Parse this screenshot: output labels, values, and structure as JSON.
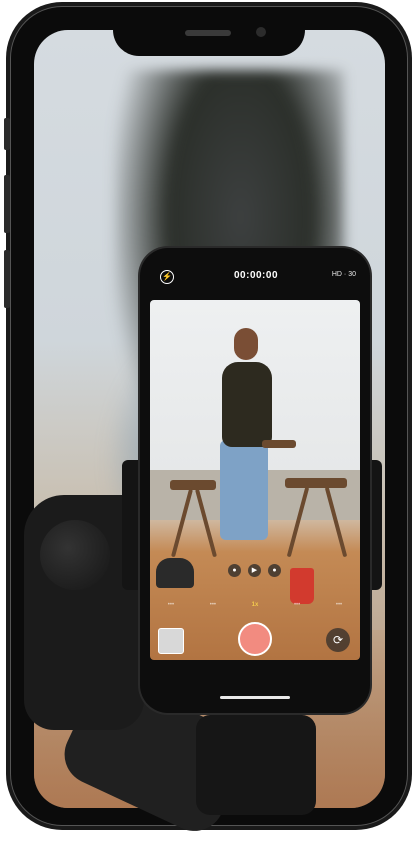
{
  "camera": {
    "timer": "00:00:00",
    "quality": "HD · 30",
    "flash_icon": "flash-off-icon",
    "mode_icons": [
      "lock-icon",
      "play-icon",
      "lock-icon"
    ],
    "speed_options": [
      "•••",
      "•••",
      "1x",
      "•••",
      "•••"
    ],
    "active_speed": "1x",
    "record_color": "#f28b80",
    "flip_icon": "rotate-camera-icon"
  },
  "device": {
    "frame_color": "#0b0b0b"
  }
}
